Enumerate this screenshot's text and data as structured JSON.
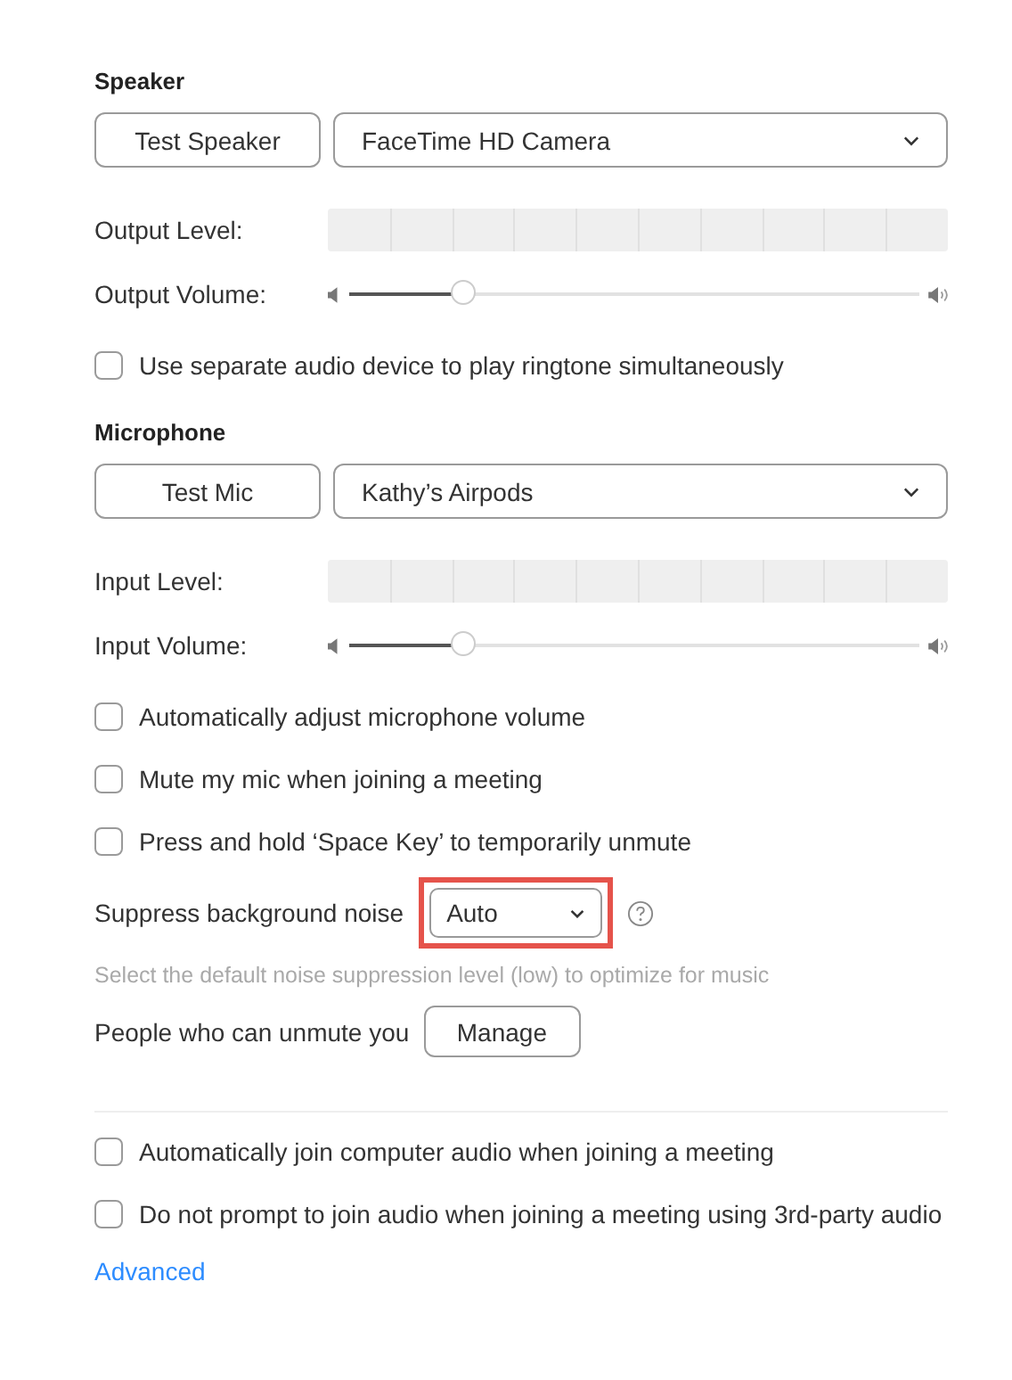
{
  "speaker": {
    "heading": "Speaker",
    "test_button": "Test Speaker",
    "device": "FaceTime HD Camera",
    "level_label": "Output Level:",
    "volume_label": "Output Volume:",
    "volume": {
      "level": 0.2
    },
    "options": [
      {
        "label": "Use separate audio device to play ringtone simultaneously",
        "checked": false
      }
    ]
  },
  "microphone": {
    "heading": "Microphone",
    "test_button": "Test Mic",
    "device": "Kathy’s Airpods",
    "level_label": "Input Level:",
    "volume_label": "Input Volume:",
    "volume": {
      "level": 0.2
    },
    "options": [
      {
        "label": "Automatically adjust microphone volume",
        "checked": false
      },
      {
        "label": "Mute my mic when joining a meeting",
        "checked": false
      },
      {
        "label": "Press and hold ‘Space Key’ to temporarily unmute",
        "checked": false
      }
    ],
    "noise": {
      "label": "Suppress background noise",
      "value": "Auto",
      "highlighted": true,
      "hint": "Select the default noise suppression level (low) to optimize for music"
    },
    "unmute": {
      "label": "People who can unmute you",
      "button": "Manage"
    }
  },
  "audio_options": [
    {
      "label": "Automatically join computer audio when joining a meeting",
      "checked": false
    },
    {
      "label": "Do not prompt to join audio when joining a meeting using 3rd-party audio",
      "checked": false
    }
  ],
  "advanced_link": "Advanced"
}
